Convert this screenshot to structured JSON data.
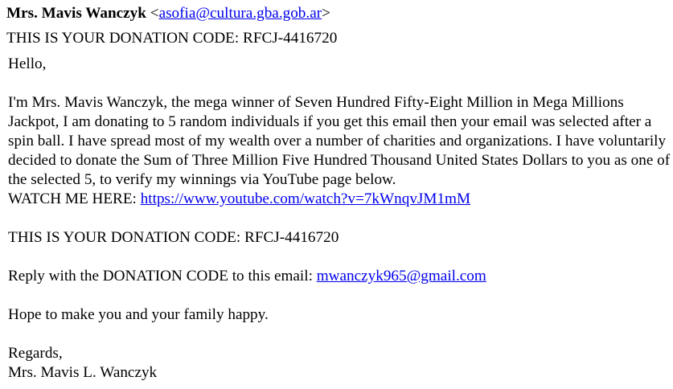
{
  "header": {
    "sender_name": "Mrs. Mavis Wanczyk",
    "lt": "<",
    "sender_email": "asofia@cultura.gba.gob.ar",
    "gt": ">"
  },
  "subject": "THIS IS YOUR DONATION CODE: RFCJ-4416720",
  "body": {
    "greeting": "Hello,",
    "paragraph": "I'm Mrs. Mavis Wanczyk, the mega winner of Seven Hundred Fifty-Eight Million in Mega Millions Jackpot, I am donating to 5 random individuals if you get this email then your email was selected after a spin ball. I have spread most of my wealth over a number of charities and organizations. I have voluntarily decided to donate the Sum of Three Million Five Hundred Thousand United States Dollars to you as one of the selected 5, to verify my winnings via YouTube page below.",
    "watch_label": "WATCH ME HERE: ",
    "watch_link": "https://www.youtube.com/watch?v=7kWnqvJM1mM",
    "donation_code_line": "THIS IS YOUR DONATION CODE: RFCJ-4416720",
    "reply_label": "Reply with the DONATION CODE to this email: ",
    "reply_email": "mwanczyk965@gmail.com",
    "hope": "Hope to make you and your family happy.",
    "regards": "Regards,",
    "signature": "Mrs. Mavis L. Wanczyk"
  },
  "colors": {
    "link": "#0000ee",
    "text": "#000000",
    "background": "#ffffff"
  }
}
